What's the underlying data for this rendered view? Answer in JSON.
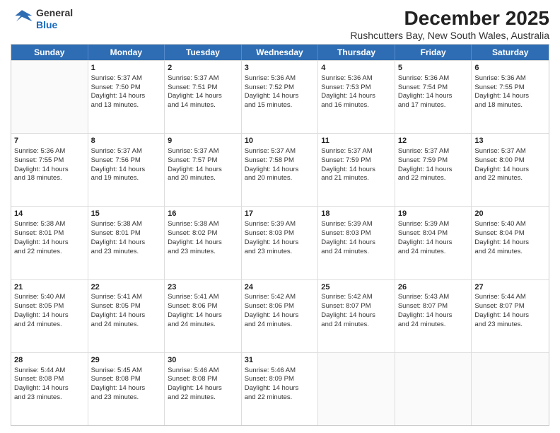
{
  "logo": {
    "line1": "General",
    "line2": "Blue"
  },
  "title": "December 2025",
  "subtitle": "Rushcutters Bay, New South Wales, Australia",
  "header_days": [
    "Sunday",
    "Monday",
    "Tuesday",
    "Wednesday",
    "Thursday",
    "Friday",
    "Saturday"
  ],
  "weeks": [
    [
      {
        "day": "",
        "lines": []
      },
      {
        "day": "1",
        "lines": [
          "Sunrise: 5:37 AM",
          "Sunset: 7:50 PM",
          "Daylight: 14 hours",
          "and 13 minutes."
        ]
      },
      {
        "day": "2",
        "lines": [
          "Sunrise: 5:37 AM",
          "Sunset: 7:51 PM",
          "Daylight: 14 hours",
          "and 14 minutes."
        ]
      },
      {
        "day": "3",
        "lines": [
          "Sunrise: 5:36 AM",
          "Sunset: 7:52 PM",
          "Daylight: 14 hours",
          "and 15 minutes."
        ]
      },
      {
        "day": "4",
        "lines": [
          "Sunrise: 5:36 AM",
          "Sunset: 7:53 PM",
          "Daylight: 14 hours",
          "and 16 minutes."
        ]
      },
      {
        "day": "5",
        "lines": [
          "Sunrise: 5:36 AM",
          "Sunset: 7:54 PM",
          "Daylight: 14 hours",
          "and 17 minutes."
        ]
      },
      {
        "day": "6",
        "lines": [
          "Sunrise: 5:36 AM",
          "Sunset: 7:55 PM",
          "Daylight: 14 hours",
          "and 18 minutes."
        ]
      }
    ],
    [
      {
        "day": "7",
        "lines": [
          "Sunrise: 5:36 AM",
          "Sunset: 7:55 PM",
          "Daylight: 14 hours",
          "and 18 minutes."
        ]
      },
      {
        "day": "8",
        "lines": [
          "Sunrise: 5:37 AM",
          "Sunset: 7:56 PM",
          "Daylight: 14 hours",
          "and 19 minutes."
        ]
      },
      {
        "day": "9",
        "lines": [
          "Sunrise: 5:37 AM",
          "Sunset: 7:57 PM",
          "Daylight: 14 hours",
          "and 20 minutes."
        ]
      },
      {
        "day": "10",
        "lines": [
          "Sunrise: 5:37 AM",
          "Sunset: 7:58 PM",
          "Daylight: 14 hours",
          "and 20 minutes."
        ]
      },
      {
        "day": "11",
        "lines": [
          "Sunrise: 5:37 AM",
          "Sunset: 7:59 PM",
          "Daylight: 14 hours",
          "and 21 minutes."
        ]
      },
      {
        "day": "12",
        "lines": [
          "Sunrise: 5:37 AM",
          "Sunset: 7:59 PM",
          "Daylight: 14 hours",
          "and 22 minutes."
        ]
      },
      {
        "day": "13",
        "lines": [
          "Sunrise: 5:37 AM",
          "Sunset: 8:00 PM",
          "Daylight: 14 hours",
          "and 22 minutes."
        ]
      }
    ],
    [
      {
        "day": "14",
        "lines": [
          "Sunrise: 5:38 AM",
          "Sunset: 8:01 PM",
          "Daylight: 14 hours",
          "and 22 minutes."
        ]
      },
      {
        "day": "15",
        "lines": [
          "Sunrise: 5:38 AM",
          "Sunset: 8:01 PM",
          "Daylight: 14 hours",
          "and 23 minutes."
        ]
      },
      {
        "day": "16",
        "lines": [
          "Sunrise: 5:38 AM",
          "Sunset: 8:02 PM",
          "Daylight: 14 hours",
          "and 23 minutes."
        ]
      },
      {
        "day": "17",
        "lines": [
          "Sunrise: 5:39 AM",
          "Sunset: 8:03 PM",
          "Daylight: 14 hours",
          "and 23 minutes."
        ]
      },
      {
        "day": "18",
        "lines": [
          "Sunrise: 5:39 AM",
          "Sunset: 8:03 PM",
          "Daylight: 14 hours",
          "and 24 minutes."
        ]
      },
      {
        "day": "19",
        "lines": [
          "Sunrise: 5:39 AM",
          "Sunset: 8:04 PM",
          "Daylight: 14 hours",
          "and 24 minutes."
        ]
      },
      {
        "day": "20",
        "lines": [
          "Sunrise: 5:40 AM",
          "Sunset: 8:04 PM",
          "Daylight: 14 hours",
          "and 24 minutes."
        ]
      }
    ],
    [
      {
        "day": "21",
        "lines": [
          "Sunrise: 5:40 AM",
          "Sunset: 8:05 PM",
          "Daylight: 14 hours",
          "and 24 minutes."
        ]
      },
      {
        "day": "22",
        "lines": [
          "Sunrise: 5:41 AM",
          "Sunset: 8:05 PM",
          "Daylight: 14 hours",
          "and 24 minutes."
        ]
      },
      {
        "day": "23",
        "lines": [
          "Sunrise: 5:41 AM",
          "Sunset: 8:06 PM",
          "Daylight: 14 hours",
          "and 24 minutes."
        ]
      },
      {
        "day": "24",
        "lines": [
          "Sunrise: 5:42 AM",
          "Sunset: 8:06 PM",
          "Daylight: 14 hours",
          "and 24 minutes."
        ]
      },
      {
        "day": "25",
        "lines": [
          "Sunrise: 5:42 AM",
          "Sunset: 8:07 PM",
          "Daylight: 14 hours",
          "and 24 minutes."
        ]
      },
      {
        "day": "26",
        "lines": [
          "Sunrise: 5:43 AM",
          "Sunset: 8:07 PM",
          "Daylight: 14 hours",
          "and 24 minutes."
        ]
      },
      {
        "day": "27",
        "lines": [
          "Sunrise: 5:44 AM",
          "Sunset: 8:07 PM",
          "Daylight: 14 hours",
          "and 23 minutes."
        ]
      }
    ],
    [
      {
        "day": "28",
        "lines": [
          "Sunrise: 5:44 AM",
          "Sunset: 8:08 PM",
          "Daylight: 14 hours",
          "and 23 minutes."
        ]
      },
      {
        "day": "29",
        "lines": [
          "Sunrise: 5:45 AM",
          "Sunset: 8:08 PM",
          "Daylight: 14 hours",
          "and 23 minutes."
        ]
      },
      {
        "day": "30",
        "lines": [
          "Sunrise: 5:46 AM",
          "Sunset: 8:08 PM",
          "Daylight: 14 hours",
          "and 22 minutes."
        ]
      },
      {
        "day": "31",
        "lines": [
          "Sunrise: 5:46 AM",
          "Sunset: 8:09 PM",
          "Daylight: 14 hours",
          "and 22 minutes."
        ]
      },
      {
        "day": "",
        "lines": []
      },
      {
        "day": "",
        "lines": []
      },
      {
        "day": "",
        "lines": []
      }
    ]
  ]
}
